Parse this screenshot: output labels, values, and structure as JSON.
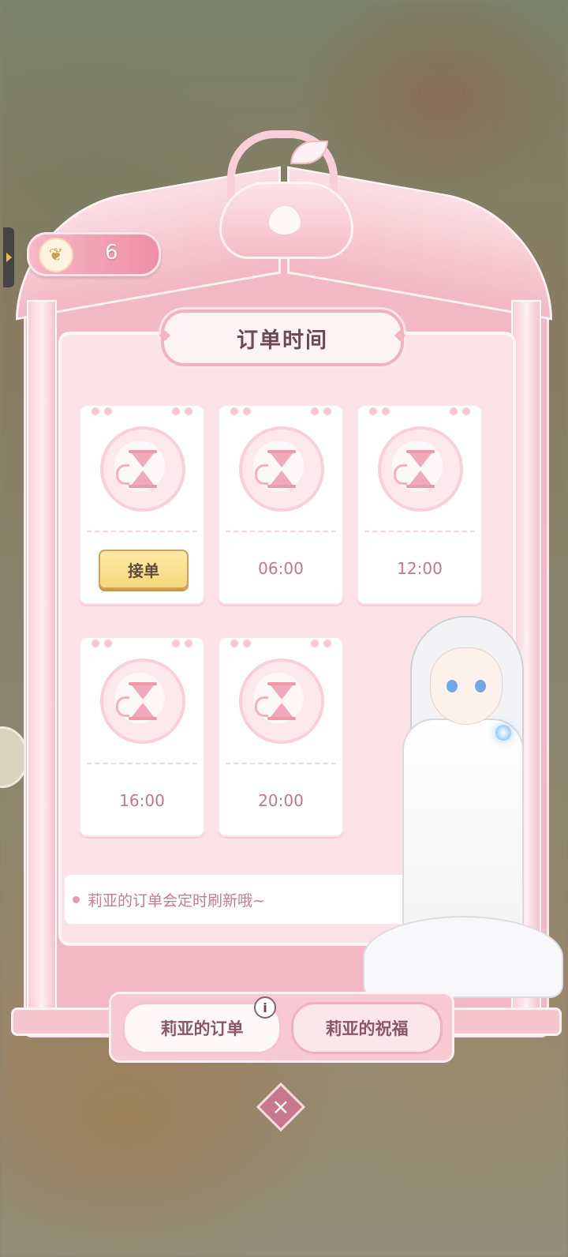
{
  "currency": {
    "icon": "wing-feather-icon",
    "count": "6"
  },
  "panel": {
    "title": "订单时间"
  },
  "orders": [
    {
      "type": "button",
      "label": "接单"
    },
    {
      "type": "time",
      "label": "06:00"
    },
    {
      "type": "time",
      "label": "12:00"
    },
    {
      "type": "time",
      "label": "16:00"
    },
    {
      "type": "time",
      "label": "20:00"
    }
  ],
  "notice": {
    "text": "莉亚的订单会定时刷新哦~"
  },
  "tabs": [
    {
      "label": "莉亚的订单",
      "active": true
    },
    {
      "label": "莉亚的祝福",
      "active": false
    }
  ],
  "info": {
    "symbol": "i"
  },
  "close": {
    "symbol": "×"
  },
  "colors": {
    "accent": "#f3b8c5",
    "button": "#f7d77c",
    "text": "#c0788b"
  }
}
